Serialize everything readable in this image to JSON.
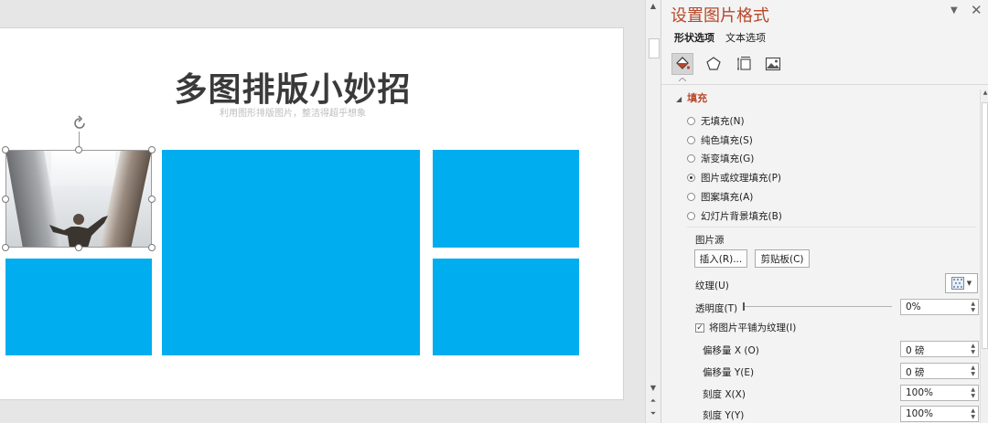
{
  "slide": {
    "title": "多图排版小妙招",
    "subtitle": "利用图形排版图片，整洁得超乎想象",
    "accent_color": "#00adef"
  },
  "panel": {
    "title": "设置图片格式",
    "menu_icon": "dropdown-arrow-icon",
    "close_icon": "close-icon",
    "tabs": {
      "shape": "形状选项",
      "text": "文本选项"
    },
    "categories": [
      "fill-line-icon",
      "effects-icon",
      "size-layout-icon",
      "picture-icon"
    ],
    "fill_section": {
      "header": "填充",
      "options": [
        {
          "label": "无填充(N)",
          "selected": false
        },
        {
          "label": "纯色填充(S)",
          "selected": false
        },
        {
          "label": "渐变填充(G)",
          "selected": false
        },
        {
          "label": "图片或纹理填充(P)",
          "selected": true
        },
        {
          "label": "图案填充(A)",
          "selected": false
        },
        {
          "label": "幻灯片背景填充(B)",
          "selected": false
        }
      ],
      "picture_source_label": "图片源",
      "insert_button": "插入(R)...",
      "clipboard_button": "剪贴板(C)",
      "texture_label": "纹理(U)",
      "transparency_label": "透明度(T)",
      "transparency_value": "0%",
      "transparency_level": 0,
      "tile_label": "将图片平铺为纹理(I)",
      "tile_checked": true,
      "offset_x_label": "偏移量 X (O)",
      "offset_x_value": "0 磅",
      "offset_y_label": "偏移量 Y(E)",
      "offset_y_value": "0 磅",
      "scale_x_label": "刻度 X(X)",
      "scale_x_value": "100%",
      "scale_y_label": "刻度 Y(Y)",
      "scale_y_value": "100%"
    },
    "accent_color": "#b7472a"
  }
}
